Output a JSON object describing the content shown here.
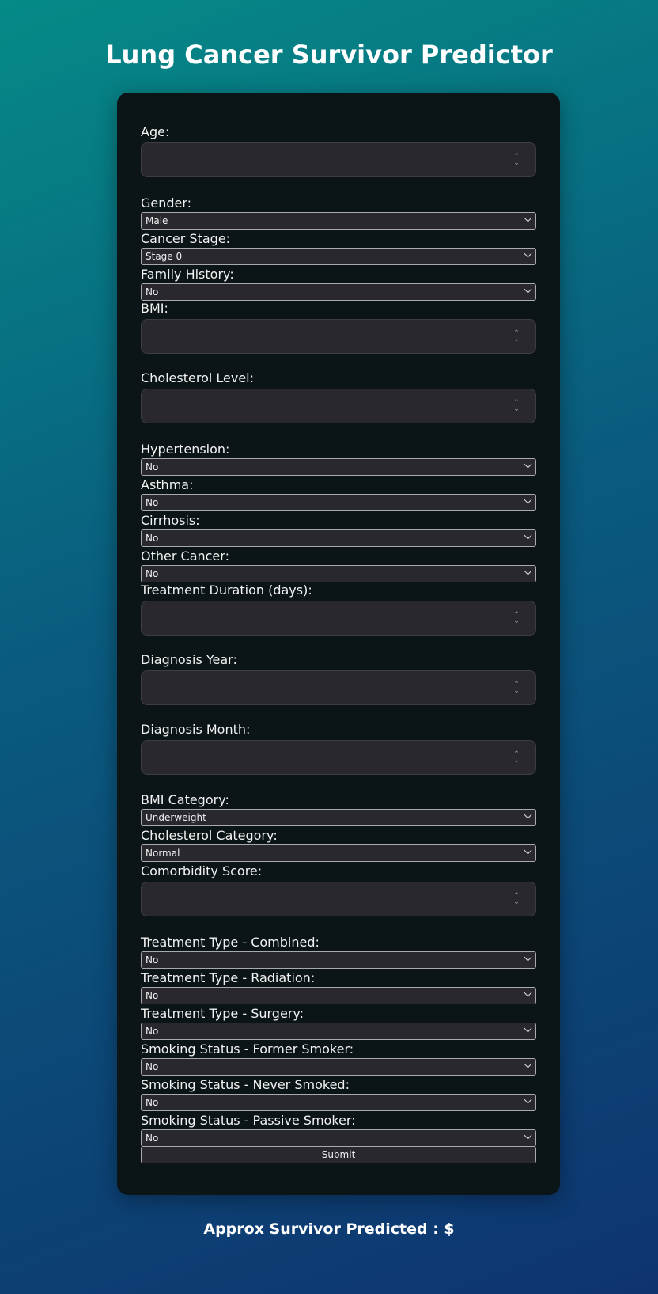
{
  "page": {
    "title": "Lung Cancer Survivor Predictor",
    "result_label": "Approx Survivor Predicted : $"
  },
  "form": {
    "fields": [
      {
        "label": "Age:",
        "type": "number",
        "value": ""
      },
      {
        "label": "Gender:",
        "type": "select",
        "value": "Male"
      },
      {
        "label": "Cancer Stage:",
        "type": "select",
        "value": "Stage 0"
      },
      {
        "label": "Family History:",
        "type": "select",
        "value": "No"
      },
      {
        "label": "BMI:",
        "type": "number",
        "value": ""
      },
      {
        "label": "Cholesterol Level:",
        "type": "number",
        "value": ""
      },
      {
        "label": "Hypertension:",
        "type": "select",
        "value": "No"
      },
      {
        "label": "Asthma:",
        "type": "select",
        "value": "No"
      },
      {
        "label": "Cirrhosis:",
        "type": "select",
        "value": "No"
      },
      {
        "label": "Other Cancer:",
        "type": "select",
        "value": "No"
      },
      {
        "label": "Treatment Duration (days):",
        "type": "number",
        "value": ""
      },
      {
        "label": "Diagnosis Year:",
        "type": "number",
        "value": ""
      },
      {
        "label": "Diagnosis Month:",
        "type": "number",
        "value": ""
      },
      {
        "label": "BMI Category:",
        "type": "select",
        "value": "Underweight"
      },
      {
        "label": "Cholesterol Category:",
        "type": "select",
        "value": "Normal"
      },
      {
        "label": "Comorbidity Score:",
        "type": "number",
        "value": ""
      },
      {
        "label": "Treatment Type - Combined:",
        "type": "select",
        "value": "No"
      },
      {
        "label": "Treatment Type - Radiation:",
        "type": "select",
        "value": "No"
      },
      {
        "label": "Treatment Type - Surgery:",
        "type": "select",
        "value": "No"
      },
      {
        "label": "Smoking Status - Former Smoker:",
        "type": "select",
        "value": "No"
      },
      {
        "label": "Smoking Status - Never Smoked:",
        "type": "select",
        "value": "No"
      },
      {
        "label": "Smoking Status - Passive Smoker:",
        "type": "select",
        "value": "No"
      }
    ],
    "submit_label": "Submit"
  },
  "icons": {
    "spinner": "spinner-arrows-icon",
    "select": "chevron-down-icon"
  },
  "colors": {
    "bg_start": "#058a87",
    "bg_end": "#0e3470",
    "card": "#0b1417",
    "input": "#29282f"
  }
}
